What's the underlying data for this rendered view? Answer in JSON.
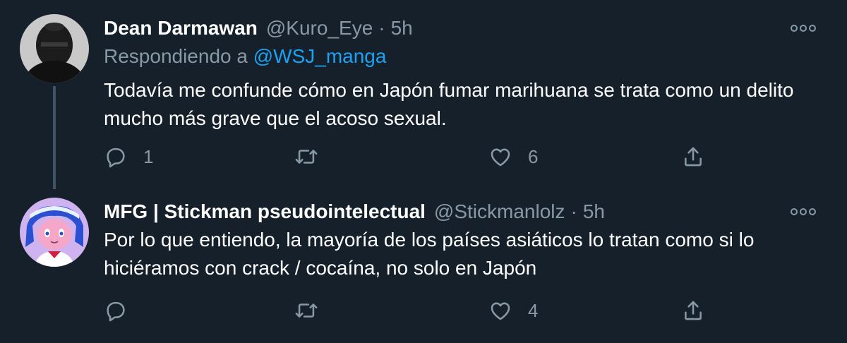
{
  "tweets": [
    {
      "author_name": "Dean Darmawan",
      "handle": "@Kuro_Eye",
      "separator": "·",
      "time": "5h",
      "reply_prefix": "Respondiendo a",
      "reply_mention": "@WSJ_manga",
      "text": "Todavía me confunde cómo en Japón fumar marihuana se trata como un delito mucho más grave que el acoso sexual.",
      "replies": "1",
      "retweets": "",
      "likes": "6"
    },
    {
      "author_name": "MFG | Stickman pseudointelectual",
      "handle": "@Stickmanlolz",
      "separator": "·",
      "time": "5h",
      "text": "Por lo que entiendo, la mayoría de los países asiáticos lo tratan como si lo hiciéramos con crack / cocaína, no solo en Japón",
      "replies": "",
      "retweets": "",
      "likes": "4"
    }
  ],
  "icons": {
    "reply": "reply-icon",
    "retweet": "retweet-icon",
    "like": "heart-icon",
    "share": "share-icon",
    "more": "more-icon"
  },
  "colors": {
    "background": "#15202b",
    "secondary_text": "#8899a6",
    "link": "#1da1f2",
    "thread_line": "#3d5466"
  }
}
